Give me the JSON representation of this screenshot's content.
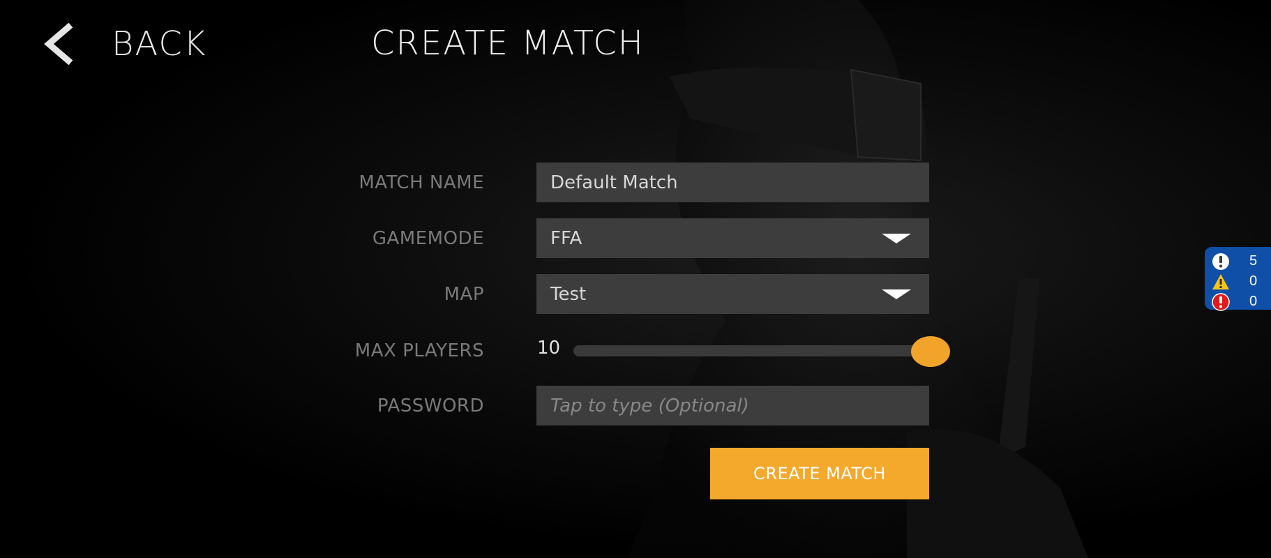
{
  "header": {
    "back_label": "BACK",
    "title": "CREATE MATCH"
  },
  "form": {
    "match_name": {
      "label": "MATCH NAME",
      "value": "Default Match"
    },
    "gamemode": {
      "label": "GAMEMODE",
      "selected": "FFA"
    },
    "map": {
      "label": "MAP",
      "selected": "Test"
    },
    "max_players": {
      "label": "MAX PLAYERS",
      "value": "10",
      "slider_fraction": 1.0
    },
    "password": {
      "label": "PASSWORD",
      "placeholder": "Tap to type (Optional)"
    },
    "submit_label": "CREATE MATCH"
  },
  "debug_console": {
    "info_count": "5",
    "warning_count": "0",
    "error_count": "0"
  },
  "colors": {
    "accent": "#f4a82c",
    "field_bg": "#3d3d3d",
    "debug_bg": "#0f4fa8"
  },
  "icons": {
    "back": "chevron-left-icon",
    "dropdown": "triangle-down-icon",
    "debug_info": "exclamation-circle-icon",
    "debug_warning": "warning-triangle-icon",
    "debug_error": "error-circle-icon"
  }
}
